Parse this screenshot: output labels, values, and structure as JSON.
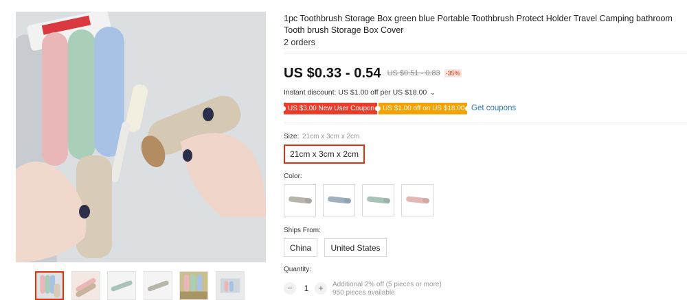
{
  "product": {
    "title": "1pc Toothbrush Storage Box green blue Portable Toothbrush Protect Holder Travel Camping bathroom Tooth brush Storage Box Cover",
    "orders": "2 orders"
  },
  "pricing": {
    "price": "US $0.33 - 0.54",
    "original_price": "US $0.51 - 0.83",
    "discount": "-35%",
    "instant_discount": "Instant discount: US $1.00 off per US $18.00",
    "instant_chevron": "⌄"
  },
  "coupons": {
    "items": [
      {
        "label": "US $3.00 New User Coupon",
        "color": "#ea3d2b"
      },
      {
        "label": "US $1.00 off on US $18.00",
        "color": "#f5a100"
      }
    ],
    "get_coupons_label": "Get coupons"
  },
  "size": {
    "label": "Size:",
    "selected_value": "21cm x 3cm x 2cm",
    "options": [
      "21cm x 3cm x 2cm"
    ]
  },
  "color": {
    "label": "Color:",
    "options": [
      {
        "icon": "gray-case-swatch",
        "color": "#b9b4ac"
      },
      {
        "icon": "blue-case-swatch",
        "color": "#9fb1bf"
      },
      {
        "icon": "green-case-swatch",
        "color": "#a9c3b8"
      },
      {
        "icon": "pink-case-swatch",
        "color": "#e3b7b5"
      }
    ]
  },
  "shipping": {
    "label": "Ships From:",
    "options": [
      "China",
      "United States"
    ]
  },
  "quantity": {
    "label": "Quantity:",
    "minus": "−",
    "plus": "+",
    "value": "1",
    "note_line1": "Additional 2% off (5 pieces or more)",
    "note_line2": "950 pieces available"
  },
  "gallery": {
    "thumbnail_count": 6,
    "active_index": 0
  },
  "theme": {
    "accent": "#e62e04",
    "link": "#2a76c3"
  }
}
